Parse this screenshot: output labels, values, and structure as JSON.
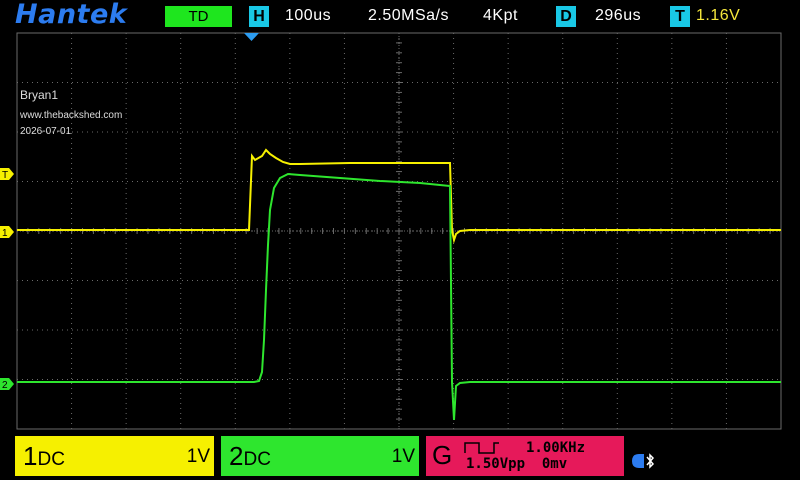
{
  "header": {
    "brand": "Hantek",
    "mode": "TD",
    "h_label": "H",
    "timebase": "100us",
    "sample_rate": "2.50MSa/s",
    "memory_depth": "4Kpt",
    "d_label": "D",
    "delay": "296us",
    "t_label": "T",
    "trigger_level": "1.16V"
  },
  "annotations": {
    "name": "Bryan1",
    "website": "www.thebackshed.com",
    "date": "2026-07-01"
  },
  "markers": {
    "trigger": "T",
    "ch1": "1",
    "ch2": "2"
  },
  "channels": [
    {
      "id": "1",
      "coupling": "DC",
      "scale": "1V",
      "color": "#f6f000"
    },
    {
      "id": "2",
      "coupling": "DC",
      "scale": "1V",
      "color": "#2ee62e"
    }
  ],
  "generator": {
    "label": "G",
    "frequency": "1.00KHz",
    "amplitude": "1.50Vpp",
    "offset": "0mv"
  },
  "colors": {
    "brand": "#2c7cf0",
    "mode_bg": "#1ee61e",
    "label_bg": "#19c8e6",
    "grid": "#6a6a6a",
    "generator_bg": "#e6195a"
  }
}
